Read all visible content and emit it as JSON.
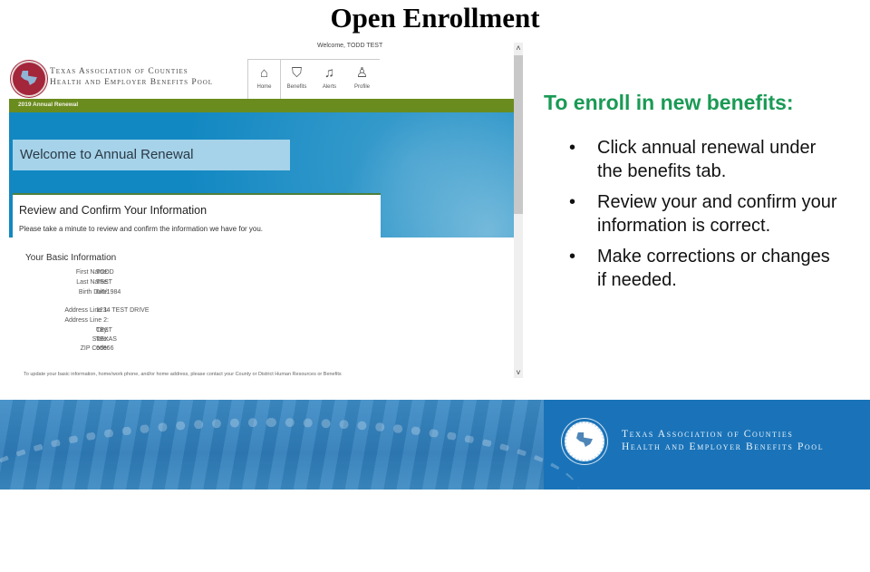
{
  "slide": {
    "title": "Open Enrollment"
  },
  "screenshot": {
    "welcome_user": "Welcome, TODD TEST",
    "org": {
      "line1": "Texas Association of Counties",
      "line2": "Health and Employer Benefits Pool"
    },
    "nav": [
      {
        "label": "Home",
        "icon": "home-icon"
      },
      {
        "label": "Benefits",
        "icon": "shield-icon"
      },
      {
        "label": "Alerts",
        "icon": "bell-icon"
      },
      {
        "label": "Profile",
        "icon": "person-icon"
      }
    ],
    "section_bar": "2019 Annual Renewal",
    "hero_banner": "Welcome to Annual Renewal",
    "card": {
      "heading": "Review and Confirm Your Information",
      "text": "Please take a minute to review and confirm the information we have for you."
    },
    "basic_info": {
      "heading": "Your Basic Information",
      "fields": [
        {
          "label": "First Name:",
          "value": "TODD"
        },
        {
          "label": "Last Name:",
          "value": "TEST"
        },
        {
          "label": "Birth Date:",
          "value": "6/6/1984"
        },
        {
          "label": "Address Line 1:",
          "value": "1234 TEST DRIVE"
        },
        {
          "label": "Address Line 2:",
          "value": ""
        },
        {
          "label": "City:",
          "value": "TEST"
        },
        {
          "label": "State:",
          "value": "TEXAS"
        },
        {
          "label": "ZIP Code:",
          "value": "66666"
        }
      ]
    },
    "note": "To update your basic information, home/work phone, and/or home address, please contact your County or District Human Resources or Benefits",
    "scrollbar": {
      "position_fraction": 0.0,
      "visible_fraction": 0.47
    }
  },
  "instructions": {
    "title": "To enroll in new benefits:",
    "bullets": [
      "Click annual renewal under the benefits tab.",
      "Review your and confirm your information is correct.",
      "Make corrections or changes if needed."
    ]
  },
  "footer": {
    "org_line1": "Texas Association of Counties",
    "org_line2": "Health and Employer Benefits Pool"
  },
  "colors": {
    "green_bar": "#6a8c1e",
    "hero_blue": "#1288c2",
    "instr_title": "#1a9a55",
    "footer_blue": "#1a73b8",
    "seal_red": "#a3263b"
  }
}
